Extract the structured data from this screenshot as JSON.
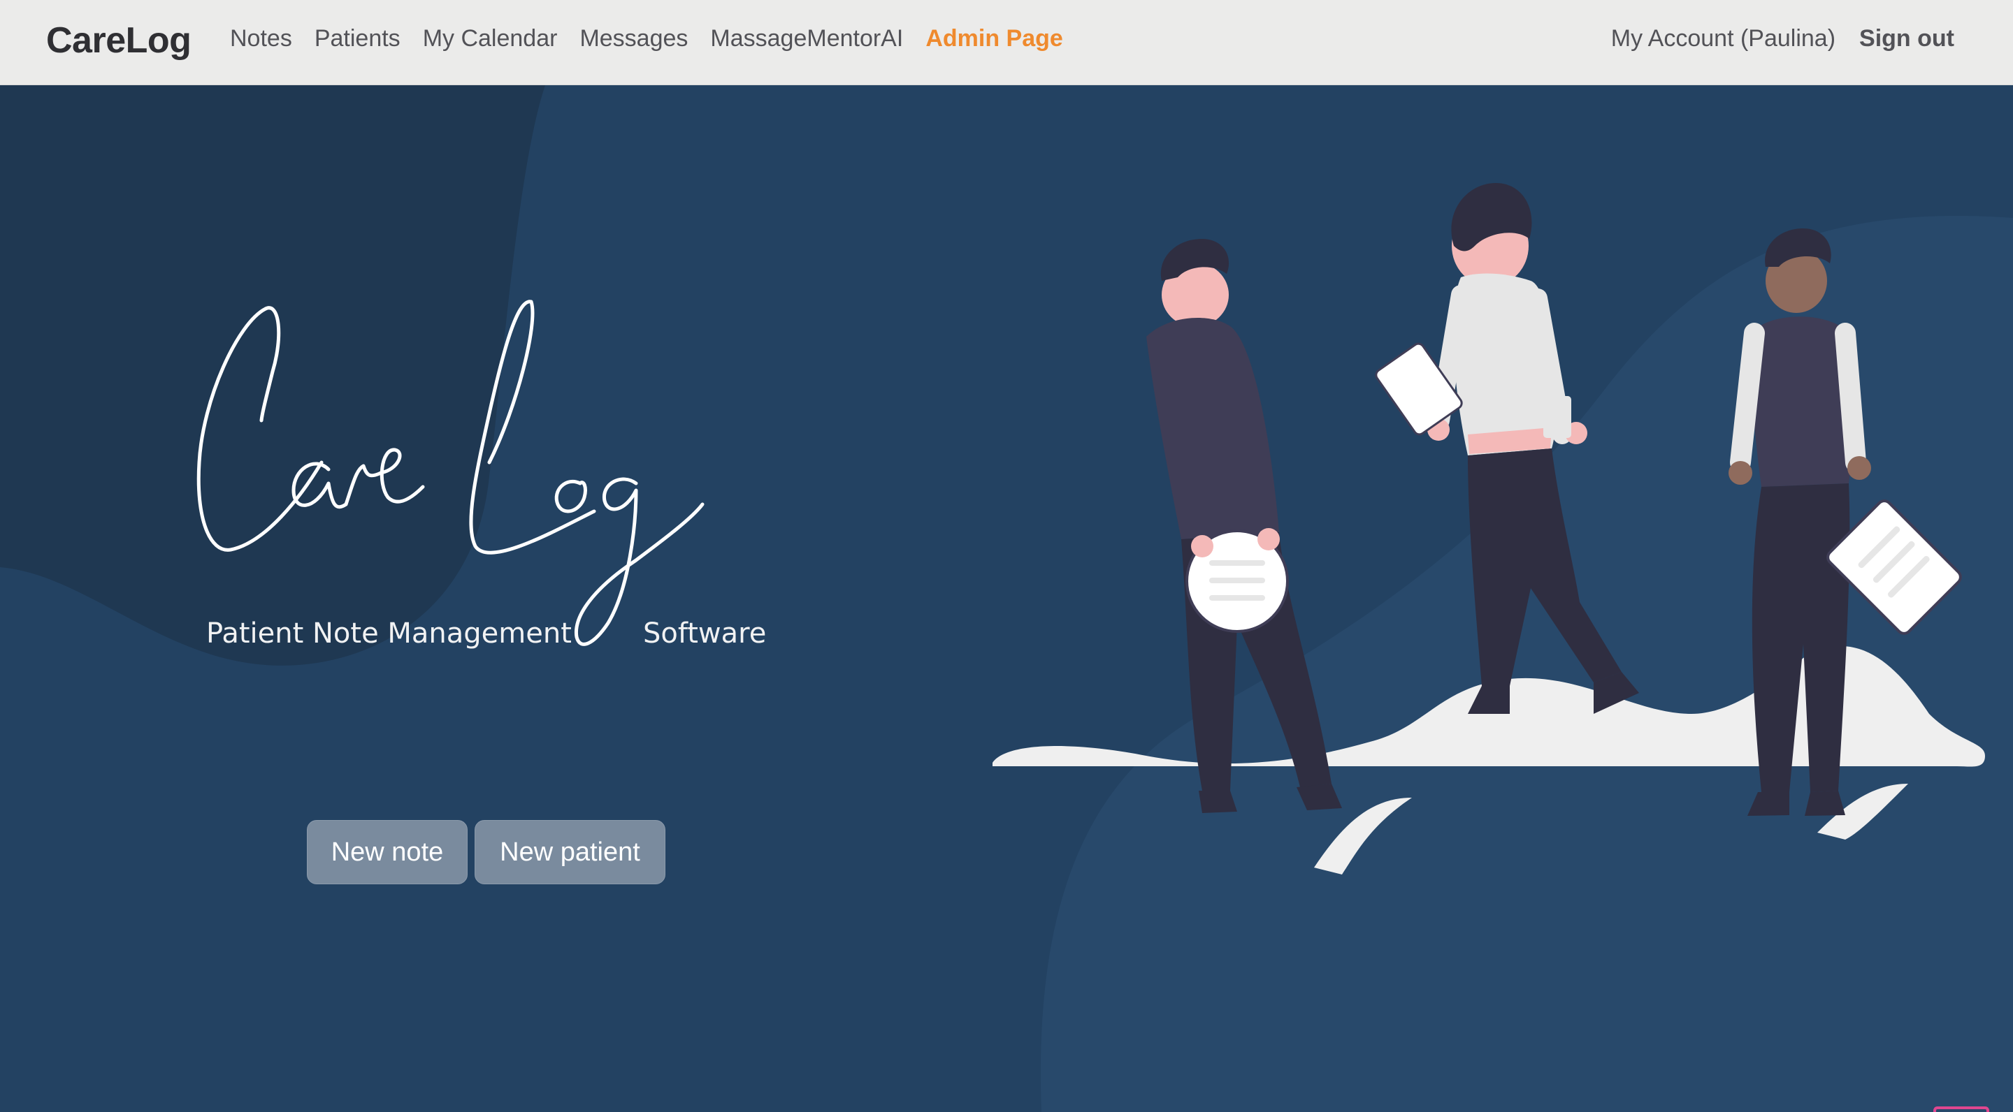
{
  "app": {
    "brand": "CareLog"
  },
  "nav": {
    "links": [
      {
        "label": "Notes"
      },
      {
        "label": "Patients"
      },
      {
        "label": "My Calendar"
      },
      {
        "label": "Messages"
      },
      {
        "label": "MassageMentorAI"
      },
      {
        "label": "Admin Page"
      }
    ],
    "account": "My Account (Paulina)",
    "signout": "Sign out"
  },
  "hero": {
    "logo_script": "CareLog",
    "tagline_part1": "Patient Note Management",
    "tagline_part2": "Software",
    "buttons": {
      "new_note": "New note",
      "new_patient": "New patient"
    }
  },
  "icons": {
    "chat": "chat-bubble-icon"
  },
  "colors": {
    "navbar_bg": "#ebebea",
    "hero_bg": "#234262",
    "hero_bg_dark": "#1f3852",
    "admin_accent": "#ef8a2e",
    "button_bg": "#7a8b9e",
    "chat_icon": "#e0468f"
  }
}
